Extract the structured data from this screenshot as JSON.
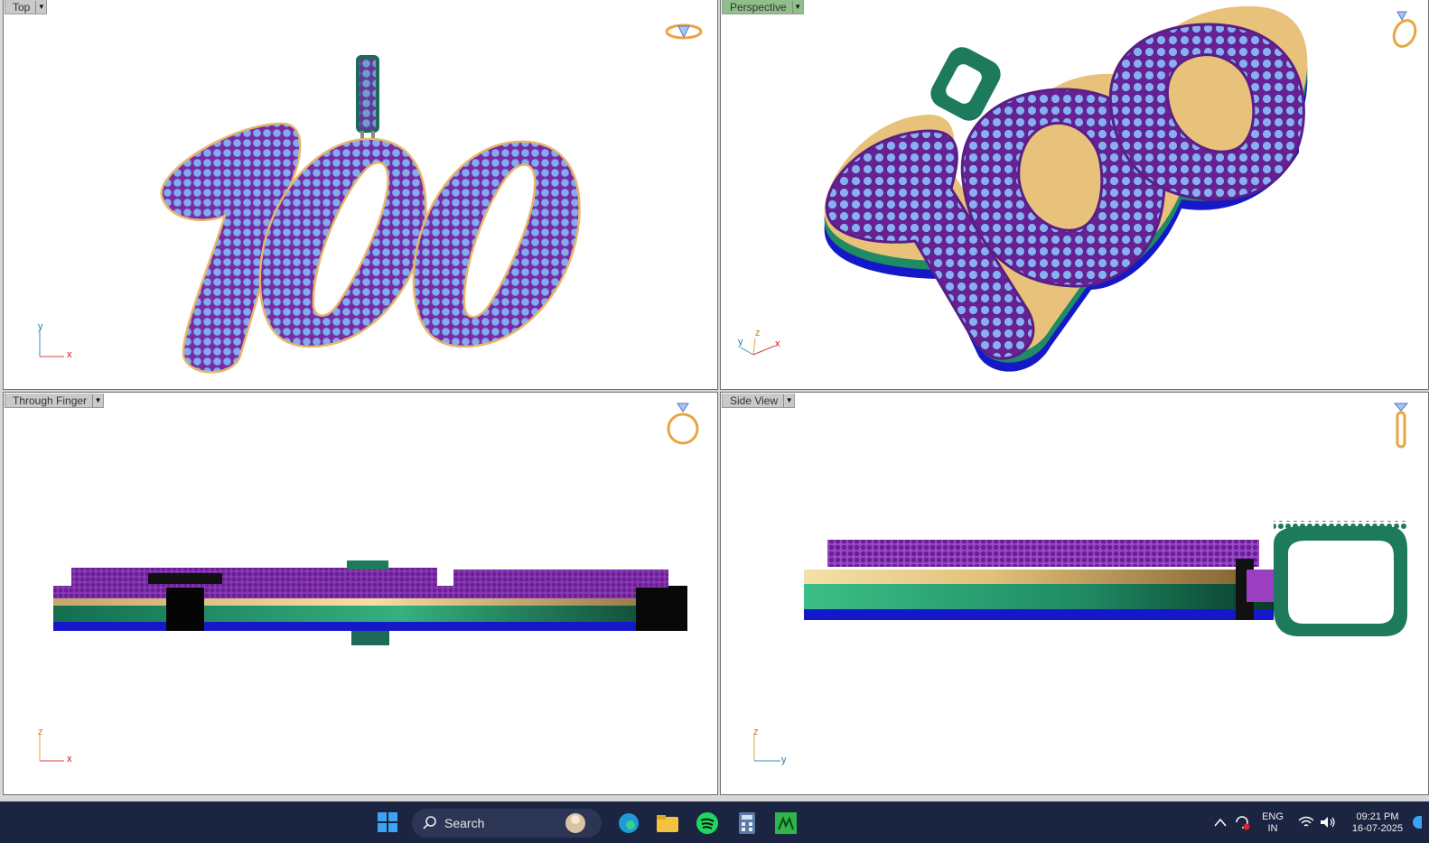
{
  "viewports": {
    "top": {
      "label": "Top",
      "axis_h": "x",
      "axis_v": "y"
    },
    "perspective": {
      "label": "Perspective",
      "axis_1": "y",
      "axis_2": "z",
      "axis_3": "x"
    },
    "through_finger": {
      "label": "Through Finger",
      "axis_h": "x",
      "axis_v": "z"
    },
    "side_view": {
      "label": "Side View",
      "axis_h": "y",
      "axis_v": "z"
    }
  },
  "model_text": "100",
  "colors": {
    "stone": "#7aa2ea",
    "prong": "#7a2aa4",
    "metal_purple": "#9a3fc0",
    "gold": "#e8c27a",
    "green": "#1f8a64",
    "blue": "#1418c8",
    "bail_green": "#1d7a5c",
    "viewport_active_tab": "#8fbf8a",
    "taskbar": "#1b2440"
  },
  "taskbar": {
    "search_label": "Search",
    "apps": [
      "windows-start-icon",
      "search-icon",
      "edge-icon",
      "file-explorer-icon",
      "spotify-icon",
      "calculator-icon",
      "matrix-app-icon"
    ],
    "tray": {
      "lang_line1": "ENG",
      "lang_line2": "IN",
      "time": "09:21 PM",
      "date": "16-07-2025"
    }
  }
}
